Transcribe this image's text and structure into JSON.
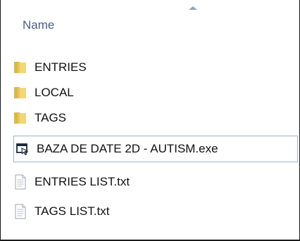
{
  "header": {
    "column_name": "Name"
  },
  "files": [
    {
      "name": "ENTRIES",
      "icon": "folder-icon"
    },
    {
      "name": "LOCAL",
      "icon": "folder-icon"
    },
    {
      "name": "TAGS",
      "icon": "folder-icon"
    },
    {
      "name": "BAZA DE DATE 2D - AUTISM.exe",
      "icon": "application-icon",
      "selected": true
    },
    {
      "name": "ENTRIES LIST.txt",
      "icon": "text-file-icon"
    },
    {
      "name": "TAGS LIST.txt",
      "icon": "text-file-icon"
    }
  ]
}
